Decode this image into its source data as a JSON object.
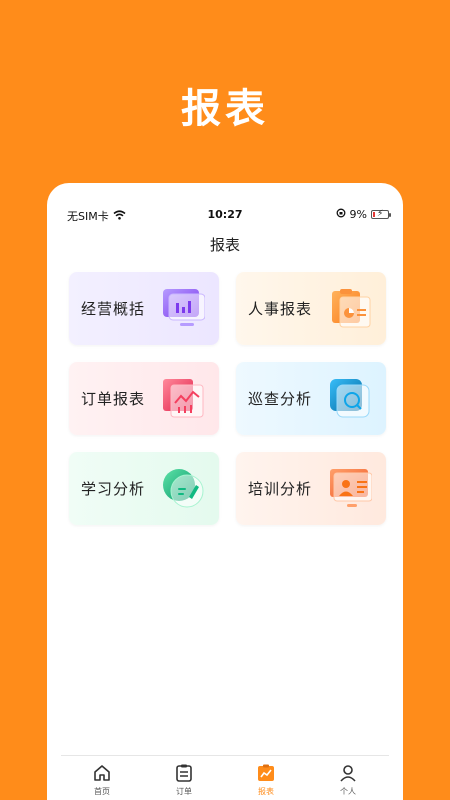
{
  "hero": {
    "title": "报表"
  },
  "status_bar": {
    "carrier": "无SIM卡",
    "time": "10:27",
    "battery": "9%"
  },
  "header": {
    "title": "报表"
  },
  "cards": [
    {
      "label": "经营概括",
      "icon": "monitor-chart-icon"
    },
    {
      "label": "人事报表",
      "icon": "clipboard-chart-icon"
    },
    {
      "label": "订单报表",
      "icon": "line-chart-icon"
    },
    {
      "label": "巡查分析",
      "icon": "search-scan-icon"
    },
    {
      "label": "学习分析",
      "icon": "pen-note-icon"
    },
    {
      "label": "培训分析",
      "icon": "presentation-person-icon"
    }
  ],
  "tabbar": {
    "items": [
      {
        "label": "首页",
        "icon": "home-icon",
        "active": false
      },
      {
        "label": "订单",
        "icon": "order-list-icon",
        "active": false
      },
      {
        "label": "报表",
        "icon": "report-icon",
        "active": true
      },
      {
        "label": "个人",
        "icon": "person-icon",
        "active": false
      }
    ]
  },
  "colors": {
    "brand": "#FF8C1A",
    "accent_purple": "#8B5CF6",
    "accent_orange": "#FB923C",
    "accent_pink": "#F43F5E",
    "accent_blue": "#0EA5E9",
    "accent_green": "#10B981",
    "accent_peach": "#F97316"
  }
}
